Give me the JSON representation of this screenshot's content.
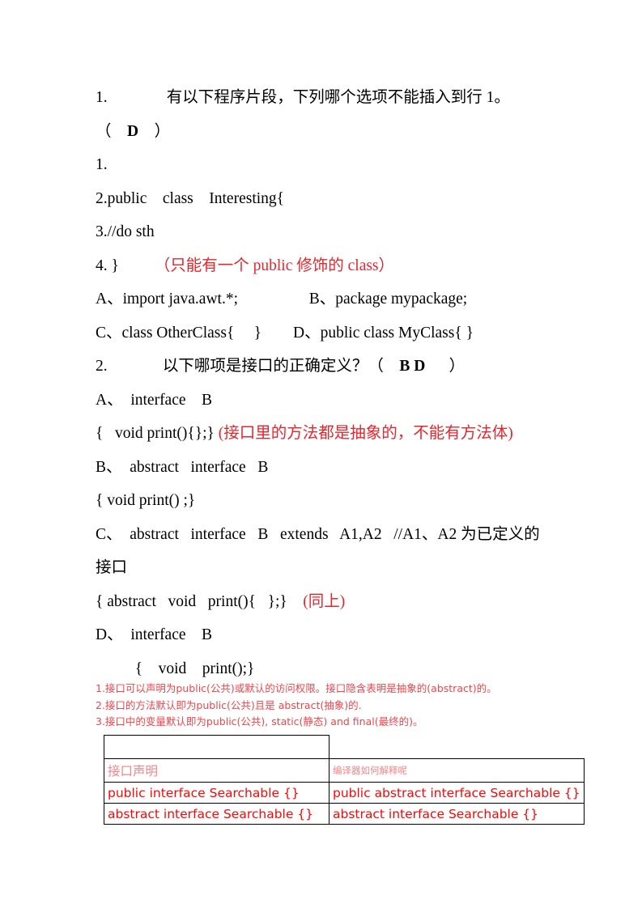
{
  "document": {
    "lines": [
      {
        "id": "q1-stem",
        "segments": [
          {
            "text": "1.               有以下程序片段，下列哪个选项不能插入到行 1。",
            "style": "plain"
          }
        ]
      },
      {
        "id": "q1-answer",
        "segments": [
          {
            "text": "（    ",
            "style": "plain"
          },
          {
            "text": "D",
            "style": "bold"
          },
          {
            "text": "    ）",
            "style": "plain"
          }
        ]
      },
      {
        "id": "code-line-1",
        "segments": [
          {
            "text": "1.",
            "style": "plain"
          }
        ]
      },
      {
        "id": "code-line-2",
        "segments": [
          {
            "text": "2.public    class    Interesting{",
            "style": "plain"
          }
        ]
      },
      {
        "id": "code-line-3",
        "segments": [
          {
            "text": "3.//do sth",
            "style": "plain"
          }
        ]
      },
      {
        "id": "code-line-4",
        "segments": [
          {
            "text": "4. }",
            "style": "plain"
          },
          {
            "text": "         （只能有一个 public 修饰的 class）",
            "style": "red"
          }
        ]
      },
      {
        "id": "q1-opt-ab",
        "segments": [
          {
            "text": "A、import java.awt.*;                  B、package mypackage;",
            "style": "plain"
          }
        ]
      },
      {
        "id": "q1-opt-cd",
        "segments": [
          {
            "text": "C、class OtherClass{     }        D、public class MyClass{ }",
            "style": "plain"
          }
        ]
      },
      {
        "id": "q2-stem",
        "segments": [
          {
            "text": "2.              以下哪项是接口的正确定义？（    ",
            "style": "plain"
          },
          {
            "text": "B D",
            "style": "bold"
          },
          {
            "text": "      ）",
            "style": "plain"
          }
        ]
      },
      {
        "id": "q2-opt-a",
        "segments": [
          {
            "text": "A、  interface    B",
            "style": "plain"
          }
        ]
      },
      {
        "id": "q2-opt-a-body",
        "segments": [
          {
            "text": "{   void print(){};}",
            "style": "plain"
          },
          {
            "text": " (接口里的方法都是抽象的，不能有方法体)",
            "style": "red"
          }
        ]
      },
      {
        "id": "q2-opt-b",
        "segments": [
          {
            "text": "B、  abstract   interface   B",
            "style": "plain"
          }
        ]
      },
      {
        "id": "q2-opt-b-body",
        "segments": [
          {
            "text": "{ void print() ;}",
            "style": "plain"
          }
        ]
      },
      {
        "id": "q2-opt-c",
        "segments": [
          {
            "text": "C、  abstract   interface   B   extends   A1,A2   //A1、A2 为已定义的",
            "style": "plain"
          }
        ]
      },
      {
        "id": "q2-opt-c-cont",
        "segments": [
          {
            "text": "接口",
            "style": "plain"
          }
        ]
      },
      {
        "id": "q2-opt-c-body",
        "segments": [
          {
            "text": "{ abstract   void   print(){   };}",
            "style": "plain"
          },
          {
            "text": "    (同上)",
            "style": "red"
          }
        ]
      },
      {
        "id": "q2-opt-d",
        "segments": [
          {
            "text": "D、  interface    B",
            "style": "plain"
          }
        ]
      },
      {
        "id": "q2-opt-d-body",
        "segments": [
          {
            "text": "          {    void    print();}",
            "style": "plain"
          }
        ]
      }
    ],
    "notes": [
      "1.接口可以声明为public(公共)或默认的访问权限。接口隐含表明是抽象的(abstract)的。",
      "2.接口的方法默认即为public(公共)且是 abstract(抽象)的.",
      "3.接口中的变量默认即为public(公共), static(静态) and final(最终的)。"
    ],
    "table": {
      "header": {
        "left": "接口声明",
        "right": "编译器如何解释呢"
      },
      "rows": [
        {
          "left": "public interface Searchable {}",
          "right": "public abstract interface Searchable {}"
        },
        {
          "left": "abstract interface Searchable {}",
          "right": "abstract interface Searchable {}"
        }
      ]
    }
  },
  "colors": {
    "body_text": "#000000",
    "annotation_red": "#e8252c",
    "note_red": "#f0454b",
    "table_code_red": "#fb0606",
    "table_header_red": "#f2868a",
    "page_background": "#ffffff"
  }
}
